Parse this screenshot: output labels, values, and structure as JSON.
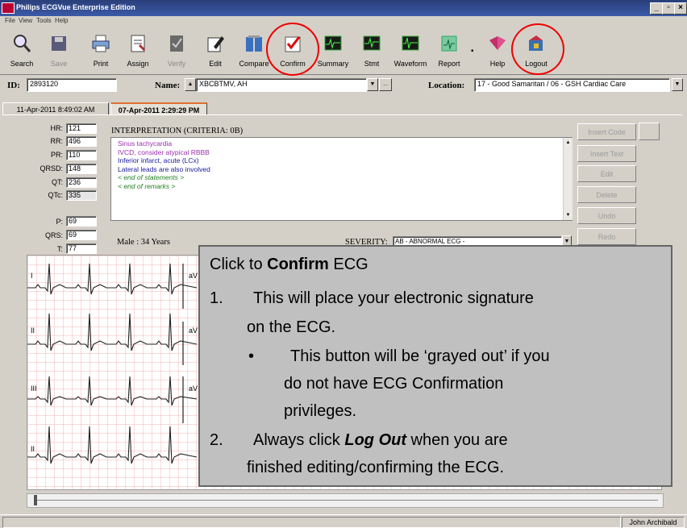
{
  "window": {
    "title": "Philips ECGVue Enterprise Edition",
    "controls": [
      "_",
      "▫",
      "×"
    ]
  },
  "menu": {
    "items": [
      "File",
      "View",
      "Tools",
      "Help"
    ]
  },
  "toolbar": {
    "buttons": [
      {
        "label": "Search",
        "icon": "search-icon",
        "enabled": true
      },
      {
        "label": "Save",
        "icon": "save-icon",
        "enabled": false
      },
      {
        "label": "Print",
        "icon": "print-icon",
        "enabled": true
      },
      {
        "label": "Assign",
        "icon": "assign-icon",
        "enabled": true
      },
      {
        "label": "Verify",
        "icon": "verify-icon",
        "enabled": false
      },
      {
        "label": "Edit",
        "icon": "edit-icon",
        "enabled": true
      },
      {
        "label": "Compare",
        "icon": "compare-icon",
        "enabled": true
      },
      {
        "label": "Confirm",
        "icon": "confirm-icon",
        "enabled": true
      },
      {
        "label": "Summary",
        "icon": "summary-icon",
        "enabled": true
      },
      {
        "label": "Stmt",
        "icon": "stmt-icon",
        "enabled": true
      },
      {
        "label": "Waveform",
        "icon": "waveform-icon",
        "enabled": true
      },
      {
        "label": "Report",
        "icon": "report-icon",
        "enabled": true
      },
      {
        "label": "Help",
        "icon": "help-icon",
        "enabled": true
      },
      {
        "label": "Logout",
        "icon": "logout-icon",
        "enabled": true
      }
    ]
  },
  "patient": {
    "id_label": "ID:",
    "id_value": "2893120",
    "name_label": "Name:",
    "name_value": "XBCBTMV, AH",
    "name_button": "...",
    "location_label": "Location:",
    "location_value": "17 - Good Samaritan / 06 - GSH Cardiac Care"
  },
  "tabs": [
    {
      "label": "11-Apr-2011 8:49:02 AM",
      "active": false
    },
    {
      "label": "07-Apr-2011 2:29:29 PM",
      "active": true
    }
  ],
  "measurements": [
    {
      "label": "HR:",
      "value": "121"
    },
    {
      "label": "RR:",
      "value": "496"
    },
    {
      "label": "PR:",
      "value": "110"
    },
    {
      "label": "QRSD:",
      "value": "148"
    },
    {
      "label": "QT:",
      "value": "236"
    },
    {
      "label": "QTc:",
      "value": "335"
    }
  ],
  "axes": [
    {
      "label": "P:",
      "value": "69"
    },
    {
      "label": "QRS:",
      "value": "69"
    },
    {
      "label": "T:",
      "value": "77"
    }
  ],
  "interpretation": {
    "heading": "INTERPRETATION (CRITERIA: 0B)",
    "lines": [
      {
        "text": "Sinus tachycardia",
        "color": "#9b2fae"
      },
      {
        "text": "IVCD, consider atypical RBBB",
        "color": "#9b2fae"
      },
      {
        "text": "Inferior infarct, acute (LCx)",
        "color": "#1a1aa0",
        "bold_prefix": "Inferior"
      },
      {
        "text": "Lateral leads are also involved",
        "color": "#9b2fae",
        "bold_prefix": "Lateral"
      },
      {
        "text": "< end of statements >",
        "color": "#208020"
      },
      {
        "text": "< end of remarks >",
        "color": "#208020"
      }
    ]
  },
  "side_buttons": [
    "Insert Code",
    "Insert Text",
    "Edit",
    "Delete",
    "Undo",
    "Redo"
  ],
  "demographics": "Male : 34 Years",
  "severity": {
    "label": "SEVERITY:",
    "value": "AB - ABNORMAL ECG -"
  },
  "leads": [
    "I",
    "aV",
    "II",
    "aV",
    "III",
    "aV",
    "II"
  ],
  "callout": {
    "title_prefix": "Click to ",
    "title_bold": "Confirm",
    "title_suffix": " ECG",
    "item1_num": "1.",
    "item1_line1": "This will place your electronic signature",
    "item1_line2": "on the ECG.",
    "bullet": "•",
    "sub_line1": "This button will be ‘grayed out’  if you",
    "sub_line2": "do not have ECG Confirmation",
    "sub_line3": "privileges.",
    "item2_num": "2.",
    "item2_prefix": "Always click ",
    "item2_bold": "Log Out",
    "item2_suffix": " when you are",
    "item2_line2": "finished editing/confirming the ECG."
  },
  "status": {
    "user": "John Archibald"
  },
  "colors": {
    "titlebar": "#2a3f7a",
    "ring": "#e00000",
    "ecg_grid": "#f2a0a0"
  }
}
